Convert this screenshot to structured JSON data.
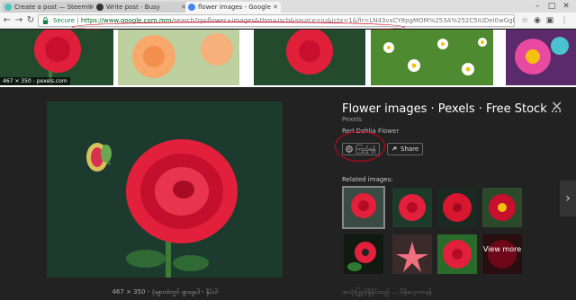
{
  "browser": {
    "tabs": [
      {
        "label": "Create a post — Steemit",
        "icon_color": "#4ec2c0"
      },
      {
        "label": "Write post - Busy",
        "icon_color": "#333333"
      },
      {
        "label": "flower images - Google",
        "icon_color": "#4285f4"
      }
    ],
    "secure_label": "Secure",
    "url_host": "https://www.google.com.mm",
    "url_rest": "/search?q=flower+images&tbm=isch&source=iu&ictx=1&fir=LN43vxCY8pgMOM%253A%252C5IUDel0wGgM23M%252C..."
  },
  "strip": {
    "caption": "467 × 350 - pexels.com"
  },
  "detail": {
    "title": "Flower images · Pexels · Free Stock ...",
    "source": "Pexels",
    "subtitle": "Red Dahlia Flower",
    "visit_label": "ကြည့်ရန်",
    "share_label": "Share",
    "related_label": "Related images:",
    "view_more": "View more",
    "image_caption": "467 × 350 - ပုံများထဲတွင် ရှာဖွေပါ - နှိပ်ပါ",
    "footer": "အသုံးပြုခွင့်ရှိနိုင်သည် ... ပိုမိုလေ့လာရန်"
  },
  "colors": {
    "accent_red": "#d0021b",
    "dark_panel": "#222222"
  }
}
